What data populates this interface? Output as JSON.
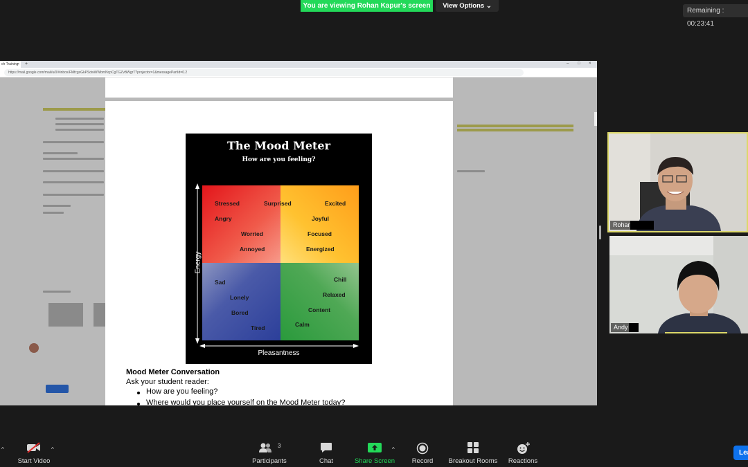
{
  "banner": {
    "sharing_text": "You are viewing Rohan Kapur's screen",
    "view_options_label": "View Options",
    "remaining_text": "Remaining : 00:23:41"
  },
  "browser": {
    "tab_label": "ch Training",
    "url": "https://mail.google.com/mail/u/0/#inbox/FMfcgxGkPSdwWWbmNcpCgTGZvBWgrT?projector=1&messagePartId=0.2"
  },
  "mood_meter": {
    "title": "The Mood Meter",
    "subtitle": "How are you feeling?",
    "y_axis": "Energy",
    "x_axis": "Pleasantness",
    "red": [
      "Stressed",
      "Angry",
      "Worried",
      "Annoyed"
    ],
    "yellow": [
      "Surprised",
      "Excited",
      "Joyful",
      "Focused",
      "Energized"
    ],
    "blue": [
      "Sad",
      "Lonely",
      "Bored",
      "Tired"
    ],
    "green": [
      "Chill",
      "Relaxed",
      "Content",
      "Calm"
    ],
    "colors": {
      "red": "#e3161b",
      "yellow": "#ffc230",
      "blue": "#2c3f9a",
      "green": "#2a9a3c"
    }
  },
  "document": {
    "heading": "Mood Meter Conversation",
    "intro": "Ask your student reader:",
    "bullets": [
      "How are you feeling?",
      "Where would you place yourself on the Mood Meter today?"
    ]
  },
  "participants": {
    "tiles": [
      {
        "name": "Rohan"
      },
      {
        "name": "Andy"
      }
    ]
  },
  "toolbar": {
    "start_video": "Start Video",
    "participants": "Participants",
    "participant_count": "3",
    "chat": "Chat",
    "share_screen": "Share Screen",
    "record": "Record",
    "breakout_rooms": "Breakout Rooms",
    "reactions": "Reactions",
    "leave": "Lea"
  },
  "colors": {
    "share_green": "#23d959",
    "leave_blue": "#0e72ed",
    "active_speaker": "#dcd86a"
  }
}
